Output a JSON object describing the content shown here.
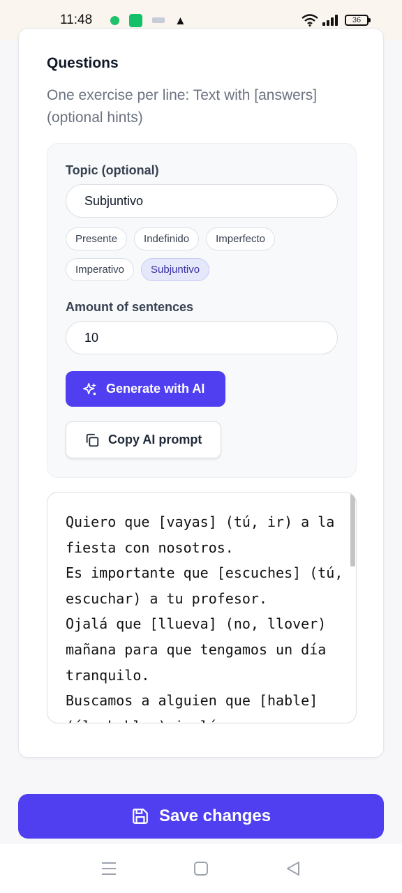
{
  "status_bar": {
    "time": "11:48",
    "battery_level": "36",
    "icons": [
      "chat-icon",
      "battery-saver-icon",
      "notification-icon",
      "warning-icon",
      "wifi-icon",
      "signal-icon",
      "battery-icon"
    ]
  },
  "questions": {
    "title": "Questions",
    "description": "One exercise per line: Text with [answers] (optional hints)"
  },
  "generator": {
    "topic_label": "Topic (optional)",
    "topic_value": "Subjuntivo",
    "topic_chips": [
      {
        "label": "Presente",
        "active": false
      },
      {
        "label": "Indefinido",
        "active": false
      },
      {
        "label": "Imperfecto",
        "active": false
      },
      {
        "label": "Imperativo",
        "active": false
      },
      {
        "label": "Subjuntivo",
        "active": true
      }
    ],
    "amount_label": "Amount of sentences",
    "amount_value": "10",
    "generate_button": "Generate with AI",
    "copy_button": "Copy AI prompt"
  },
  "editor": {
    "content": "Quiero que [vayas] (tú, ir) a la fiesta con nosotros.\nEs importante que [escuches] (tú, escuchar) a tu profesor.\nOjalá que [llueva] (no, llover) mañana para que tengamos un día tranquilo.\nBuscamos a alguien que [hable] (él, hablar) inglés y"
  },
  "footer": {
    "save_button": "Save changes"
  },
  "colors": {
    "primary": "#4f3ff0",
    "chip_active_bg": "#e5e7fb",
    "chip_active_text": "#3730a3"
  }
}
